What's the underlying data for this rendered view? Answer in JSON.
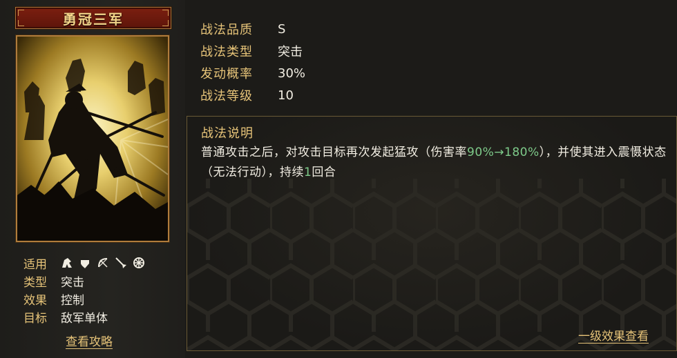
{
  "skill": {
    "name": "勇冠三军"
  },
  "stats": [
    {
      "label": "战法品质",
      "value": "S"
    },
    {
      "label": "战法类型",
      "value": "突击"
    },
    {
      "label": "发动概率",
      "value": "30%"
    },
    {
      "label": "战法等级",
      "value": "10"
    }
  ],
  "attributes": {
    "applicable_label": "适用",
    "troop_icons": [
      "cavalry-icon",
      "shield-icon",
      "bow-icon",
      "spear-icon",
      "siege-wheel-icon"
    ],
    "type_label": "类型",
    "type_value": "突击",
    "effect_label": "效果",
    "effect_value": "控制",
    "target_label": "目标",
    "target_value": "敌军单体"
  },
  "description": {
    "title": "战法说明",
    "part1": "普通攻击之后，对攻击目标再次发起猛攻（伤害率",
    "damage_rate": "90%→180%",
    "part2": "），并使其进入震慑状态（无法行动），持续",
    "duration": "1",
    "part3": "回合"
  },
  "links": {
    "strategy": "查看攻略",
    "level_one_effect": "一级效果查看"
  },
  "colors": {
    "gold_label": "#e7c479",
    "highlight_green": "#7ecb8a",
    "title_red": "#6a180c"
  }
}
